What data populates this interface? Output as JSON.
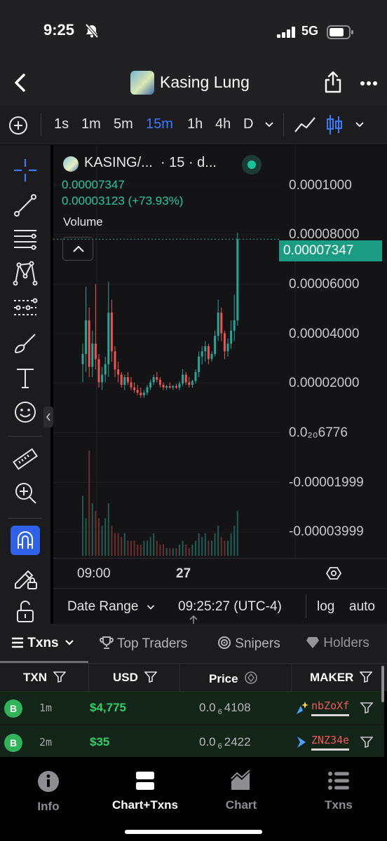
{
  "status": {
    "time": "9:25",
    "network": "5G"
  },
  "header": {
    "title": "Kasing Lung"
  },
  "timeframes": [
    {
      "label": "1s",
      "active": false
    },
    {
      "label": "1m",
      "active": false
    },
    {
      "label": "5m",
      "active": false
    },
    {
      "label": "15m",
      "active": true
    },
    {
      "label": "1h",
      "active": false
    },
    {
      "label": "4h",
      "active": false
    },
    {
      "label": "D",
      "active": false
    }
  ],
  "legend": {
    "title": "KASING/...",
    "interval": "· 15 · d...",
    "price": "0.00007347",
    "change": "0.00003123 (+73.93%)",
    "volume_label": "Volume"
  },
  "colors": {
    "up": "#26a69a",
    "down": "#ef5350",
    "accent": "#3c7bff",
    "buy": "#2fb45a"
  },
  "chart_data": {
    "type": "candlestick",
    "price_axis_ticks": [
      "0.0001000",
      "0.00008000",
      "0.00006000",
      "0.00004000",
      "0.00002000",
      "0.0₂₀6776",
      "-0.00001999",
      "-0.00003999"
    ],
    "last_price": "0.00007347",
    "time_axis_ticks": [
      "09:00",
      "27"
    ],
    "ylim": [
      -4.999e-05,
      0.0001099
    ],
    "candles": [
      [
        2.5e-05,
        3.3e-05,
        1.8e-05,
        2.9e-05
      ],
      [
        2.9e-05,
        5.5e-05,
        2.2e-05,
        4.2e-05
      ],
      [
        4.2e-05,
        4.7e-05,
        2e-05,
        2.4e-05
      ],
      [
        2.4e-05,
        3.8e-05,
        2e-05,
        3.3e-05
      ],
      [
        3.3e-05,
        5.6e-05,
        2.3e-05,
        2.7e-05
      ],
      [
        2.7e-05,
        2.9e-05,
        1.6e-05,
        1.8e-05
      ],
      [
        1.8e-05,
        2.4e-05,
        1.5e-05,
        2.1e-05
      ],
      [
        2.1e-05,
        2.8e-05,
        1.8e-05,
        2.5e-05
      ],
      [
        2.5e-05,
        5.7e-05,
        2e-05,
        4.5e-05
      ],
      [
        4.5e-05,
        5e-05,
        2.6e-05,
        3e-05
      ],
      [
        3e-05,
        3.2e-05,
        2e-05,
        2.3e-05
      ],
      [
        2.3e-05,
        2.6e-05,
        1.8e-05,
        2.1e-05
      ],
      [
        2.1e-05,
        2.2e-05,
        1.6e-05,
        1.7e-05
      ],
      [
        1.7e-05,
        2.1e-05,
        1.5e-05,
        2e-05
      ],
      [
        2e-05,
        2.2e-05,
        1.7e-05,
        1.8e-05
      ],
      [
        1.8e-05,
        2e-05,
        1.5e-05,
        1.6e-05
      ],
      [
        1.6e-05,
        1.8e-05,
        1.4e-05,
        1.5e-05
      ],
      [
        1.5e-05,
        1.7e-05,
        1.3e-05,
        1.4e-05
      ],
      [
        1.4e-05,
        1.6e-05,
        1.2e-05,
        1.3e-05
      ],
      [
        1.3e-05,
        1.5e-05,
        1.2e-05,
        1.4e-05
      ],
      [
        1.4e-05,
        1.7e-05,
        1.3e-05,
        1.6e-05
      ],
      [
        1.6e-05,
        1.9e-05,
        1.5e-05,
        1.8e-05
      ],
      [
        1.8e-05,
        2.1e-05,
        1.7e-05,
        2e-05
      ],
      [
        2e-05,
        2.2e-05,
        1.8e-05,
        1.9e-05
      ],
      [
        1.9e-05,
        2e-05,
        1.6e-05,
        1.7e-05
      ],
      [
        1.7e-05,
        1.8e-05,
        1.5e-05,
        1.6e-05
      ],
      [
        1.6e-05,
        1.7e-05,
        1.5e-05,
        1.65e-05
      ],
      [
        1.65e-05,
        1.8e-05,
        1.55e-05,
        1.6e-05
      ],
      [
        1.6e-05,
        1.7e-05,
        1.5e-05,
        1.65e-05
      ],
      [
        1.65e-05,
        1.75e-05,
        1.55e-05,
        1.6e-05
      ],
      [
        1.6e-05,
        1.85e-05,
        1.5e-05,
        1.75e-05
      ],
      [
        1.75e-05,
        2.3e-05,
        1.65e-05,
        2.1e-05
      ],
      [
        2.1e-05,
        2.2e-05,
        1.7e-05,
        1.8e-05
      ],
      [
        1.8e-05,
        2e-05,
        1.6e-05,
        1.7e-05
      ],
      [
        1.7e-05,
        1.9e-05,
        1.6e-05,
        1.85e-05
      ],
      [
        1.85e-05,
        2.3e-05,
        1.75e-05,
        2.2e-05
      ],
      [
        2.2e-05,
        3e-05,
        2e-05,
        2.8e-05
      ],
      [
        2.8e-05,
        3.2e-05,
        2.5e-05,
        3e-05
      ],
      [
        3e-05,
        3.4e-05,
        2.6e-05,
        3.2e-05
      ],
      [
        3.2e-05,
        3.3e-05,
        2.5e-05,
        2.7e-05
      ],
      [
        2.7e-05,
        3e-05,
        2.6e-05,
        2.9e-05
      ],
      [
        2.9e-05,
        3.8e-05,
        2.8e-05,
        3.6e-05
      ],
      [
        3.6e-05,
        5e-05,
        3.4e-05,
        4.5e-05
      ],
      [
        4.5e-05,
        4.7e-05,
        3.4e-05,
        3.7e-05
      ],
      [
        3.7e-05,
        3.8e-05,
        2.7e-05,
        3e-05
      ],
      [
        3e-05,
        3.5e-05,
        2.8e-05,
        3.3e-05
      ],
      [
        3.3e-05,
        4.2e-05,
        3.1e-05,
        3.8e-05
      ],
      [
        3.8e-05,
        5.2e-05,
        3.4e-05,
        4.2e-05
      ],
      [
        4.2e-05,
        7.6e-05,
        4e-05,
        7.35e-05
      ]
    ],
    "volumes": [
      0.8,
      0.5,
      1.4,
      0.7,
      0.6,
      0.5,
      0.4,
      0.5,
      0.7,
      0.4,
      0.3,
      0.3,
      0.25,
      0.3,
      0.2,
      0.2,
      0.2,
      0.15,
      0.15,
      0.2,
      0.2,
      0.25,
      0.3,
      0.2,
      0.15,
      0.15,
      0.1,
      0.1,
      0.1,
      0.1,
      0.15,
      0.2,
      0.15,
      0.1,
      0.15,
      0.2,
      0.3,
      0.25,
      0.3,
      0.2,
      0.2,
      0.3,
      0.4,
      0.25,
      0.2,
      0.2,
      0.3,
      0.4,
      0.6
    ]
  },
  "chart_footer": {
    "date_range": "Date Range",
    "clock": "09:25:27 (UTC-4)",
    "log": "log",
    "auto": "auto"
  },
  "panel_tabs": [
    {
      "label": "Txns",
      "active": true
    },
    {
      "label": "Top Traders",
      "active": false
    },
    {
      "label": "Snipers",
      "active": false
    },
    {
      "label": "Holders",
      "active": false
    }
  ],
  "table": {
    "headers": [
      "TXN",
      "USD",
      "Price",
      "MAKER"
    ],
    "rows": [
      {
        "type": "B",
        "age": "1m",
        "usd": "$4,775",
        "price_base": "0.0",
        "price_sub": "6",
        "price_rest": "4108",
        "maker": "nbZoXf"
      },
      {
        "type": "B",
        "age": "2m",
        "usd": "$35",
        "price_base": "0.0",
        "price_sub": "6",
        "price_rest": "2422",
        "maker": "ZNZ34e"
      }
    ]
  },
  "bottom_nav": [
    {
      "label": "Info",
      "icon": "info-icon",
      "active": false
    },
    {
      "label": "Chart+Txns",
      "icon": "split-view-icon",
      "active": true
    },
    {
      "label": "Chart",
      "icon": "area-chart-icon",
      "active": false
    },
    {
      "label": "Txns",
      "icon": "list-icon",
      "active": false
    }
  ]
}
